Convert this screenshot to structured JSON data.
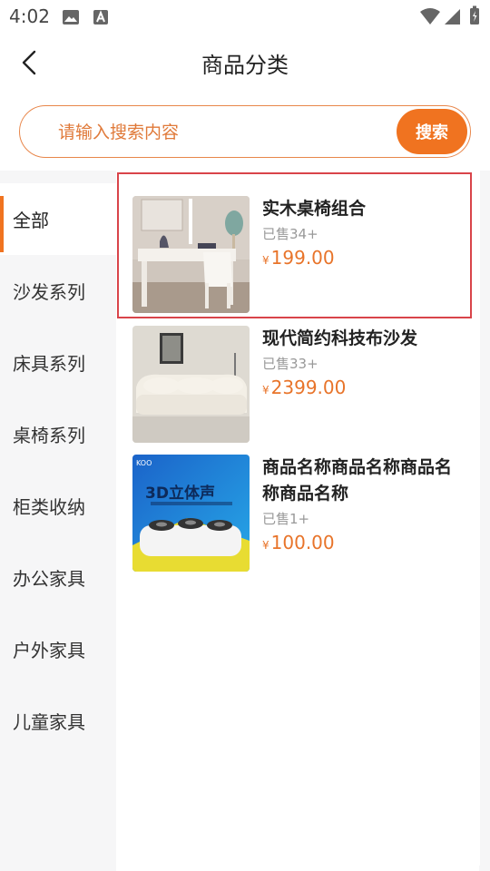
{
  "status_bar": {
    "time": "4:02"
  },
  "header": {
    "title": "商品分类"
  },
  "search": {
    "placeholder": "请输入搜索内容",
    "button_label": "搜索"
  },
  "sidebar": {
    "items": [
      {
        "label": "全部",
        "active": true
      },
      {
        "label": "沙发系列"
      },
      {
        "label": "床具系列"
      },
      {
        "label": "桌椅系列"
      },
      {
        "label": "柜类收纳"
      },
      {
        "label": "办公家具"
      },
      {
        "label": "户外家具"
      },
      {
        "label": "儿童家具"
      }
    ]
  },
  "products": [
    {
      "name": "实木桌椅组合",
      "sold": "已售34+",
      "currency": "¥",
      "price": "199.00"
    },
    {
      "name": "现代简约科技布沙发",
      "sold": "已售33+",
      "currency": "¥",
      "price": "2399.00"
    },
    {
      "name": "商品名称商品名称商品名称商品名称",
      "sold": "已售1+",
      "currency": "¥",
      "price": "100.00"
    }
  ],
  "product_image_text": {
    "brand": "KOO",
    "headline": "3D立体声"
  },
  "colors": {
    "accent": "#f07320",
    "price": "#e8742a",
    "highlight": "#d9444a"
  }
}
